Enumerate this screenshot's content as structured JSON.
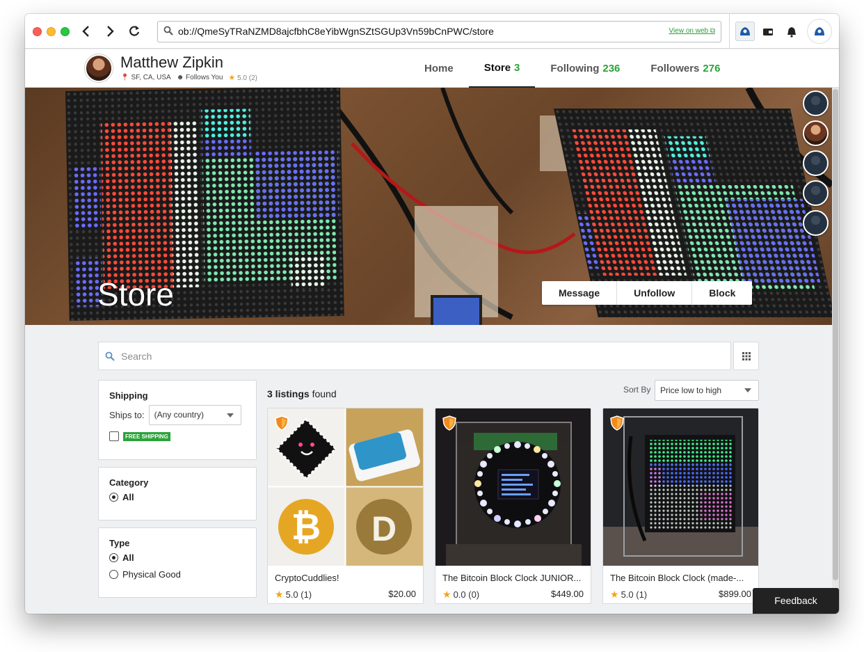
{
  "browser": {
    "url": "ob://QmeSyTRaNZMD8ajcfbhC8eYibWgnSZtSGUp3Vn59bCnPWC/store",
    "view_on_web": "View on web"
  },
  "profile": {
    "name": "Matthew Zipkin",
    "location": "SF, CA, USA",
    "follows_you": "Follows You",
    "rating": "5.0 (2)"
  },
  "tabs": [
    {
      "label": "Home",
      "count": ""
    },
    {
      "label": "Store",
      "count": "3"
    },
    {
      "label": "Following",
      "count": "236"
    },
    {
      "label": "Followers",
      "count": "276"
    }
  ],
  "banner": {
    "title": "Store",
    "actions": [
      "Message",
      "Unfollow",
      "Block"
    ]
  },
  "search": {
    "placeholder": "Search"
  },
  "filters": {
    "shipping": {
      "heading": "Shipping",
      "ships_to_label": "Ships to:",
      "ships_to_value": "(Any country)",
      "free_shipping_badge": "FREE SHIPPING"
    },
    "category": {
      "heading": "Category",
      "options": [
        "All"
      ],
      "selected": "All"
    },
    "type": {
      "heading": "Type",
      "options": [
        "All",
        "Physical Good"
      ],
      "selected": "All"
    }
  },
  "results": {
    "count": "3 listings",
    "suffix": "found",
    "sort_label": "Sort By",
    "sort_value": "Price low to high"
  },
  "listings": [
    {
      "title": "CryptoCuddlies!",
      "rating": "5.0 (1)",
      "price": "$20.00"
    },
    {
      "title": "The Bitcoin Block Clock JUNIOR...",
      "rating": "0.0 (0)",
      "price": "$449.00"
    },
    {
      "title": "The Bitcoin Block Clock (made-...",
      "rating": "5.0 (1)",
      "price": "$899.00"
    }
  ],
  "feedback": "Feedback",
  "colors": {
    "accent_green": "#2aa33a",
    "star": "#f4a31a",
    "shield": "#f08a1c"
  }
}
